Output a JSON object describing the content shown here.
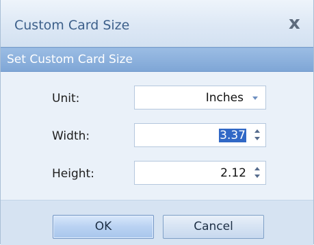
{
  "dialog": {
    "title": "Custom Card Size",
    "close_glyph": "x",
    "section_header": "Set Custom Card Size"
  },
  "fields": {
    "unit": {
      "label": "Unit:",
      "value": "Inches"
    },
    "width": {
      "label": "Width:",
      "value": "3.37"
    },
    "height": {
      "label": "Height:",
      "value": "2.12"
    }
  },
  "buttons": {
    "ok": "OK",
    "cancel": "Cancel"
  }
}
